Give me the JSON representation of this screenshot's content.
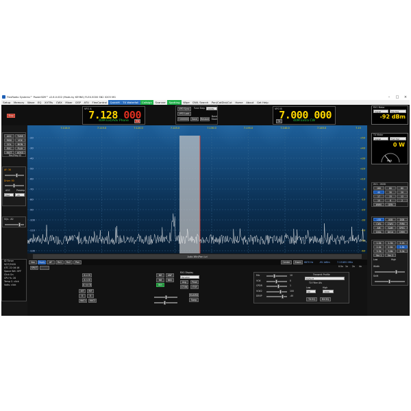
{
  "titlebar": {
    "title": "FlexRadio Systems™  PowerSDR™  v2.8.0.002  (Mods by KE9NS)  FLEX-5000  SN2  0205  MG",
    "min": "–",
    "max": "□",
    "close": "×"
  },
  "menu": [
    "Setup",
    "Memory",
    "Wave",
    "EQ",
    "XVTRs",
    "CWX",
    "Mixer",
    "DSP",
    "ATU",
    "FlexControl",
    "QuickM",
    "TX Waterfall",
    "Callsign",
    "Scanner",
    "Spotting",
    "Wipe",
    "DWL Search",
    "Pan/CatDist/Cut",
    "Home",
    "About",
    "Get Help"
  ],
  "vfo_a": {
    "label": "VFO A",
    "freq_main": "7.128",
    "freq_sub": "000",
    "mode": "40M Ext/Adv Phone",
    "tx_badge": "TX"
  },
  "vfo_b": {
    "label": "VFO B",
    "freq_main": "7.000",
    "freq_sub": "000",
    "mode": "40M Extra CW",
    "tx_badge": "TX"
  },
  "vfo_controls": {
    "sync_label": "VFO Sync",
    "tune_step_label": "Tune Step",
    "tune_step_value": "500Hz",
    "vfo_lock_label": "VFO Lock",
    "freq_readout": "7.000000",
    "save_label": "Save",
    "restore_label": "Restore",
    "band_stack_label": "Band Stack"
  },
  "left_panel": {
    "start_button": "Stop",
    "buttons": [
      "AGC",
      "TUNE",
      "MOX",
      "VOX",
      "SQL",
      "MON",
      "REC",
      "PLAY",
      "FAST",
      "AOSQ"
    ],
    "rec_play_label": "Rec/Play ID",
    "af_label": "AF: 36",
    "agc_label": "AGC",
    "drive_label": "Drive: 50",
    "line_label": "Line: 10",
    "preamp_label": "Preamp",
    "agc_value": "Med",
    "preamp_value": "-20",
    "squelch_label": "SQL: -82"
  },
  "status_panel": {
    "lines": [
      "ID Timer",
      "9/27/2020",
      "UTC 22:16:16",
      "Space WX: OFF",
      "Click On",
      "CPU %: 20",
      "Temp C: click",
      "Volts: click"
    ]
  },
  "spectrum": {
    "freq_ticks": [
      "7.110.0",
      "7.115.0",
      "7.120.0",
      "7.125.0",
      "7.130.0",
      "7.135.0",
      "7.140.0",
      "7.145.0",
      "7.15"
    ],
    "db_left": [
      "-20",
      "-30",
      "-40",
      "-50",
      "-60",
      "-70",
      "-80",
      "-90",
      "-100",
      "-110",
      "-120",
      "-130"
    ],
    "db_right": [
      "+50",
      "+40",
      "+30",
      "+20",
      "+10",
      "0",
      "-10",
      "-20",
      "-30",
      "-40",
      "-50",
      "-60"
    ],
    "title_overlay": "Auto Wtr/Pan Lvl",
    "lsb_readout": "6870 Hz",
    "dbm_readout": "-95.1dBm",
    "center_readout": "7.131851 MHz"
  },
  "meters": {
    "rx_label": "RX1 Meter",
    "rx_mode": "Signal",
    "rx_sel": "Sig Avg",
    "rx_value": "-92 dBm",
    "tx_label": "TX Meter",
    "tx_mode": "Signal",
    "tx_sel": "Fwd Pwr",
    "tx_value": "0 W",
    "pwr_label": "PWR"
  },
  "right_panel": {
    "band_title": "XV1 - 0SOK",
    "bands": [
      "160",
      "80",
      "60",
      "40",
      "30",
      "20",
      "17",
      "15",
      "12",
      "10",
      "6",
      "2",
      "WWV",
      "GEN"
    ],
    "modes": [
      "LSB",
      "USB",
      "DSB",
      "CWL",
      "CWU",
      "FMN",
      "AM",
      "SAM",
      "SPEC",
      "DIGL",
      "DIGU",
      "DRM"
    ],
    "filters": [
      "1.0k",
      "1.5k",
      "2.2k",
      "2.4k",
      "2.6k",
      "2.8k",
      "3.3k",
      "3.8k",
      "5.0k",
      "Var 1",
      "Var 2"
    ],
    "low_label": "Low",
    "high_label": "High",
    "width_label": "Width",
    "shift_label": "Shift"
  },
  "freq_strip": {
    "buttons": [
      "Vox",
      "Dsply",
      "AF",
      "Rx1",
      "Rx2",
      "Pan"
    ],
    "center_btn": "Center",
    "zoom_btn": "Zoom",
    "zoom_levels": [
      "0.5x",
      "1x",
      "2x",
      "4x"
    ]
  },
  "bottom": {
    "split_label": "SPLIT",
    "a_to_b": "A > B",
    "b_to_a": "A < B",
    "swap": "A <> B",
    "xit_label": "XIT",
    "rit_label": "RIT",
    "rit_value": "0",
    "xit_value": "0",
    "vac1": "VAC1",
    "vac2": "VAC2",
    "nr": "NR",
    "anf": "ANF",
    "nb": "NB",
    "nb2": "NB2",
    "bin": "BIN",
    "display_label": "RX1 Display",
    "display_value": "Panafall",
    "avg": "Avg",
    "peak": "Peak",
    "ctun": "CTUN",
    "rtx": "rTXF",
    "multirx": "MultiRX",
    "swap_btn": "Swap",
    "mic_label": "Mic",
    "mic_value": "10",
    "vox_label": "VOX",
    "vox_value": "0",
    "cpdr_label": "CPDR",
    "cpdr_value": "1",
    "vox2_label": "VOX2",
    "vox2_value": "100",
    "dexp_label": "DEXP",
    "dexp_value": "-40",
    "tx_profile_label": "Transmit Profile",
    "tx_profile_value": "Default",
    "tx_filter_label": "TX Filter Afu",
    "low_label": "Low",
    "high_label": "High",
    "low_value": "50",
    "high_value": "3000",
    "tx_eq": "TX EQ",
    "rx_eq": "RX EQ"
  },
  "colors": {
    "accent_green": "#2ecc40",
    "vfo_yellow": "#ffd700",
    "panel_blue": "#0a2540"
  }
}
